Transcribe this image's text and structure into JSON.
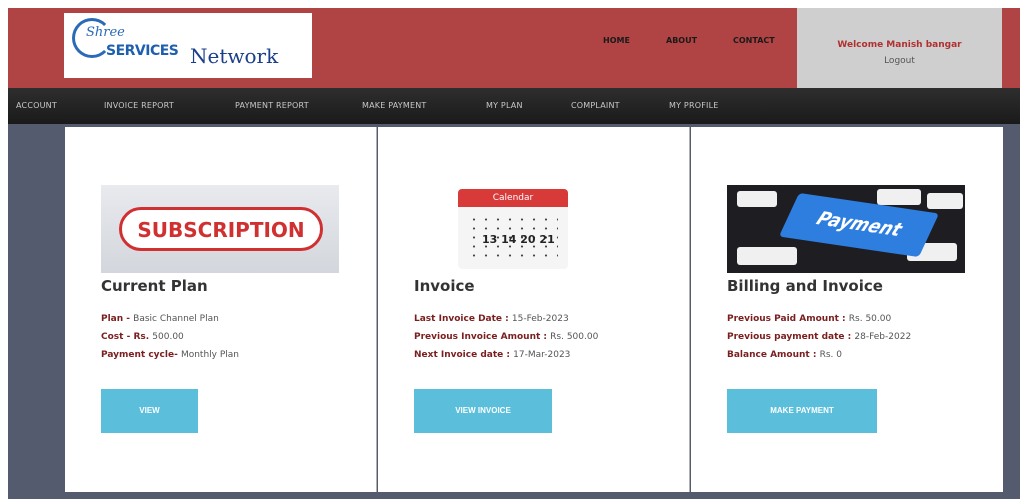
{
  "header": {
    "brand": {
      "shree": "Shree",
      "services": "SERVICES",
      "network": "Network"
    },
    "nav": [
      "HOME",
      "ABOUT",
      "CONTACT"
    ],
    "welcome": "Welcome Manish bangar",
    "logout": "Logout"
  },
  "menu": [
    "ACCOUNT",
    "INVOICE REPORT",
    "PAYMENT REPORT",
    "MAKE PAYMENT",
    "MY PLAN",
    "COMPLAINT",
    "MY PROFILE"
  ],
  "cards": [
    {
      "image_text": "SUBSCRIPTION",
      "title": "Current Plan",
      "lines": [
        {
          "label": "Plan - ",
          "value": "Basic Channel Plan"
        },
        {
          "label": "Cost - Rs. ",
          "value": "500.00"
        },
        {
          "label": "Payment cycle- ",
          "value": "Monthly Plan"
        }
      ],
      "button": "VIEW"
    },
    {
      "image_text": "Calendar",
      "image_numbers": "13  14\n20  21",
      "title": "Invoice",
      "lines": [
        {
          "label": "Last Invoice Date : ",
          "value": "15-Feb-2023"
        },
        {
          "label": "Previous Invoice Amount : ",
          "value": "Rs. 500.00"
        },
        {
          "label": "Next Invoice date : ",
          "value": "17-Mar-2023"
        }
      ],
      "button": "VIEW INVOICE"
    },
    {
      "image_text": "Payment",
      "title": "Billing and Invoice",
      "lines": [
        {
          "label": "Previous Paid Amount : ",
          "value": "Rs. 50.00"
        },
        {
          "label": "Previous payment date : ",
          "value": "28-Feb-2022"
        },
        {
          "label": "Balance Amount : ",
          "value": "Rs. 0"
        }
      ],
      "button": "MAKE PAYMENT"
    }
  ],
  "colors": {
    "header": "#b04444",
    "welcome_box": "#cfcfcf",
    "menubar": "#222222",
    "content_bg": "#555b6e",
    "button": "#5bbfdc",
    "label": "#7a1f1f"
  }
}
